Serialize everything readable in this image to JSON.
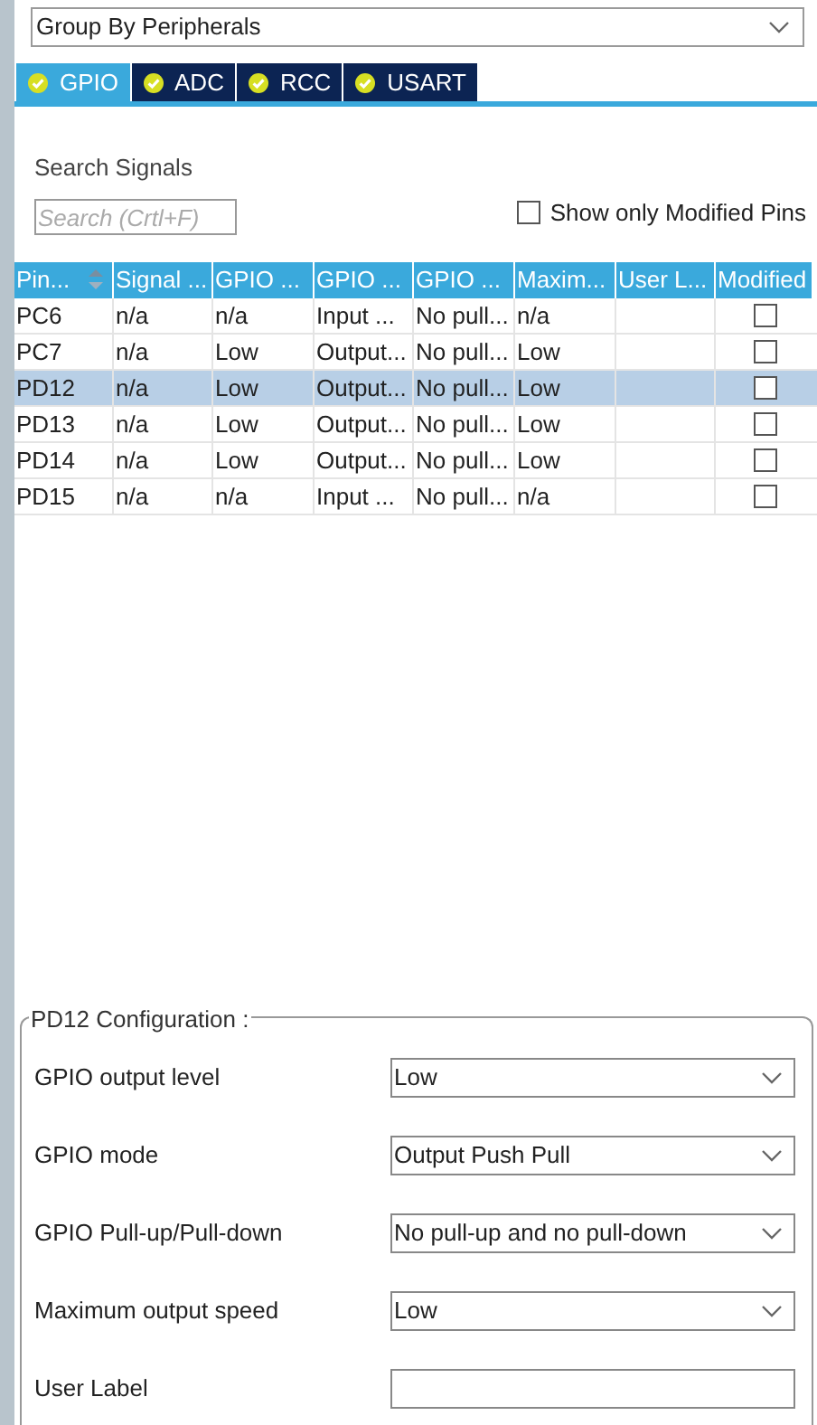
{
  "group_by": {
    "value": "Group By Peripherals"
  },
  "tabs": [
    {
      "label": "GPIO",
      "selected": true
    },
    {
      "label": "ADC",
      "selected": false
    },
    {
      "label": "RCC",
      "selected": false
    },
    {
      "label": "USART",
      "selected": false
    }
  ],
  "search": {
    "label": "Search Signals",
    "placeholder": "Search (Crtl+F)"
  },
  "show_only_modified": {
    "label": "Show only Modified Pins",
    "checked": false
  },
  "table": {
    "columns": [
      {
        "label": "Pin...",
        "sortable": true
      },
      {
        "label": "Signal ...",
        "sortable": false
      },
      {
        "label": "GPIO ...",
        "sortable": false
      },
      {
        "label": "GPIO ...",
        "sortable": false
      },
      {
        "label": "GPIO ...",
        "sortable": false
      },
      {
        "label": "Maxim...",
        "sortable": false
      },
      {
        "label": "User L...",
        "sortable": false
      },
      {
        "label": "Modified",
        "sortable": false
      }
    ],
    "rows": [
      {
        "cells": [
          "PC6",
          "n/a",
          "n/a",
          "Input ...",
          "No pull...",
          "n/a",
          ""
        ],
        "modified": false,
        "selected": false
      },
      {
        "cells": [
          "PC7",
          "n/a",
          "Low",
          "Output...",
          "No pull...",
          "Low",
          ""
        ],
        "modified": false,
        "selected": false
      },
      {
        "cells": [
          "PD12",
          "n/a",
          "Low",
          "Output...",
          "No pull...",
          "Low",
          ""
        ],
        "modified": false,
        "selected": true
      },
      {
        "cells": [
          "PD13",
          "n/a",
          "Low",
          "Output...",
          "No pull...",
          "Low",
          ""
        ],
        "modified": false,
        "selected": false
      },
      {
        "cells": [
          "PD14",
          "n/a",
          "Low",
          "Output...",
          "No pull...",
          "Low",
          ""
        ],
        "modified": false,
        "selected": false
      },
      {
        "cells": [
          "PD15",
          "n/a",
          "n/a",
          "Input ...",
          "No pull...",
          "n/a",
          ""
        ],
        "modified": false,
        "selected": false
      }
    ]
  },
  "configuration": {
    "title": "PD12 Configuration :",
    "fields": [
      {
        "label": "GPIO output level",
        "kind": "select",
        "value": "Low"
      },
      {
        "label": "GPIO mode",
        "kind": "select",
        "value": "Output Push Pull"
      },
      {
        "label": "GPIO Pull-up/Pull-down",
        "kind": "select",
        "value": "No pull-up and no pull-down"
      },
      {
        "label": "Maximum output speed",
        "kind": "select",
        "value": "Low"
      },
      {
        "label": "User Label",
        "kind": "text"
      }
    ]
  }
}
